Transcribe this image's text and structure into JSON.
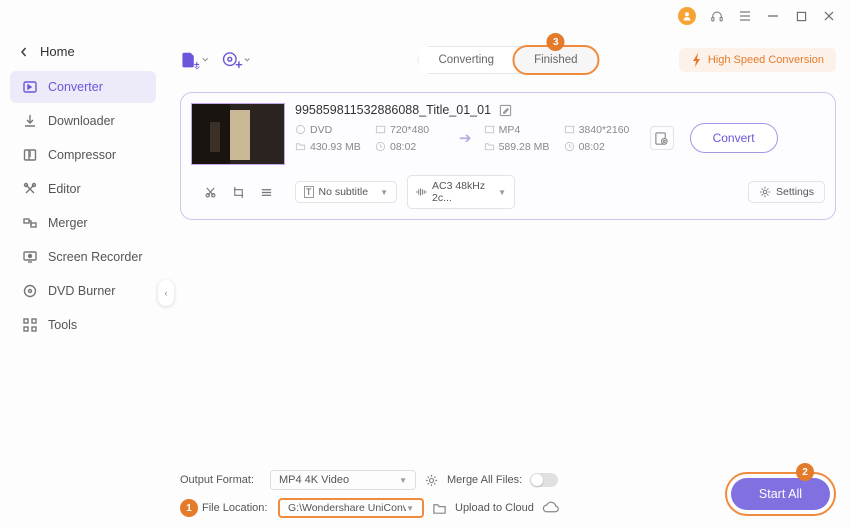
{
  "titlebar": {},
  "home_label": "Home",
  "sidebar": {
    "items": [
      {
        "label": "Converter"
      },
      {
        "label": "Downloader"
      },
      {
        "label": "Compressor"
      },
      {
        "label": "Editor"
      },
      {
        "label": "Merger"
      },
      {
        "label": "Screen Recorder"
      },
      {
        "label": "DVD Burner"
      },
      {
        "label": "Tools"
      }
    ]
  },
  "tabs": {
    "converting": "Converting",
    "finished": "Finished"
  },
  "speed_badge": "High Speed Conversion",
  "file": {
    "title": "995859811532886088_Title_01_01",
    "src": {
      "format": "DVD",
      "res": "720*480",
      "size": "430.93 MB",
      "dur": "08:02"
    },
    "dst": {
      "format": "MP4",
      "res": "3840*2160",
      "size": "589.28 MB",
      "dur": "08:02"
    },
    "convert_label": "Convert",
    "subtitle": "No subtitle",
    "audio": "AC3 48kHz 2c...",
    "settings_label": "Settings"
  },
  "footer": {
    "output_format_label": "Output Format:",
    "output_format_value": "MP4 4K Video",
    "file_location_label": "File Location:",
    "file_location_value": "G:\\Wondershare UniConverter",
    "merge_label": "Merge All Files:",
    "upload_label": "Upload to Cloud",
    "start_all": "Start All"
  },
  "callouts": {
    "c1": "1",
    "c2": "2",
    "c3": "3"
  }
}
